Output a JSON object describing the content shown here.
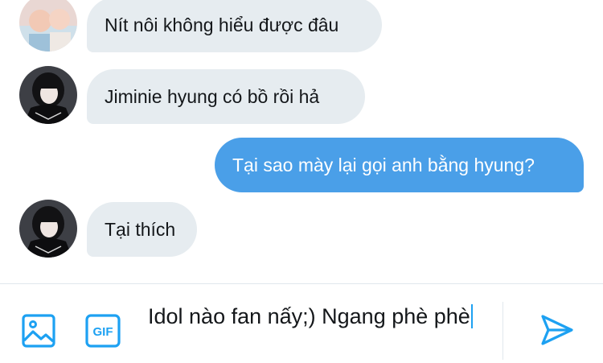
{
  "messages": [
    {
      "text": "Nít nôi không hiểu được đâu",
      "direction": "in"
    },
    {
      "text": "Jiminie hyung có bồ rồi hả",
      "direction": "in"
    },
    {
      "text": "Tại sao mày lại gọi anh bằng hyung?",
      "direction": "out"
    },
    {
      "text": "Tại thích",
      "direction": "in"
    }
  ],
  "composer": {
    "text": "Idol nào fan nấy;) Ngang phè phè",
    "icons": [
      "image-icon",
      "gif-icon",
      "send-icon"
    ]
  },
  "colors": {
    "accent": "#1da1f2",
    "outgoing_bubble": "#4a9fe8",
    "incoming_bubble": "#e6ecf0"
  }
}
